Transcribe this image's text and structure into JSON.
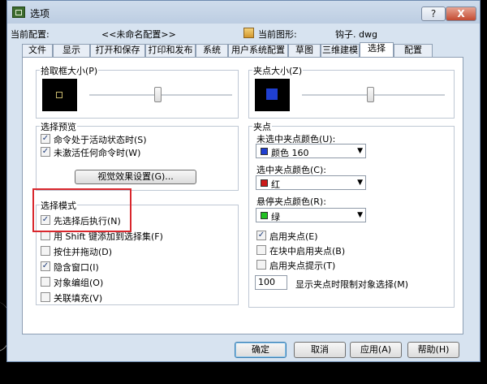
{
  "window": {
    "title": "选项",
    "help_label": "?",
    "close_label": "X"
  },
  "info": {
    "current_profile_label": "当前配置:",
    "current_profile_value": "<<未命名配置>>",
    "current_drawing_label": "当前图形:",
    "current_drawing_value": "钩子. dwg"
  },
  "tabs": [
    "文件",
    "显示",
    "打开和保存",
    "打印和发布",
    "系统",
    "用户系统配置",
    "草图",
    "三维建模",
    "选择",
    "配置"
  ],
  "active_tab": "选择",
  "pickbox": {
    "label": "拾取框大小(P)",
    "level": 0.48
  },
  "grip_size": {
    "label": "夹点大小(Z)",
    "level": 0.48
  },
  "selection_preview": {
    "label": "选择预览",
    "options": [
      {
        "label": "命令处于活动状态时(S)",
        "checked": true
      },
      {
        "label": "未激活任何命令时(W)",
        "checked": true
      }
    ],
    "visual_effects_button": "视觉效果设置(G)..."
  },
  "selection_modes": {
    "label": "选择模式",
    "options": [
      {
        "label": "先选择后执行(N)",
        "checked": true
      },
      {
        "label": "用 Shift 键添加到选择集(F)",
        "checked": false
      },
      {
        "label": "按住并拖动(D)",
        "checked": false
      },
      {
        "label": "隐含窗口(I)",
        "checked": true
      },
      {
        "label": "对象编组(O)",
        "checked": false
      },
      {
        "label": "关联填充(V)",
        "checked": false
      }
    ]
  },
  "grips": {
    "label": "夹点",
    "unselected_label": "未选中夹点颜色(U):",
    "unselected_value": "颜色 160",
    "unselected_color": "#1f3fd1",
    "selected_label": "选中夹点颜色(C):",
    "selected_value": "红",
    "selected_color": "#cc1a1a",
    "hover_label": "悬停夹点颜色(R):",
    "hover_value": "绿",
    "hover_color": "#22c022",
    "options": [
      {
        "label": "启用夹点(E)",
        "checked": true
      },
      {
        "label": "在块中启用夹点(B)",
        "checked": false
      },
      {
        "label": "启用夹点提示(T)",
        "checked": false
      }
    ],
    "limit_value": "100",
    "limit_label": "显示夹点时限制对象选择(M)"
  },
  "footer": {
    "ok": "确定",
    "cancel": "取消",
    "apply": "应用(A)",
    "help": "帮助(H)"
  }
}
